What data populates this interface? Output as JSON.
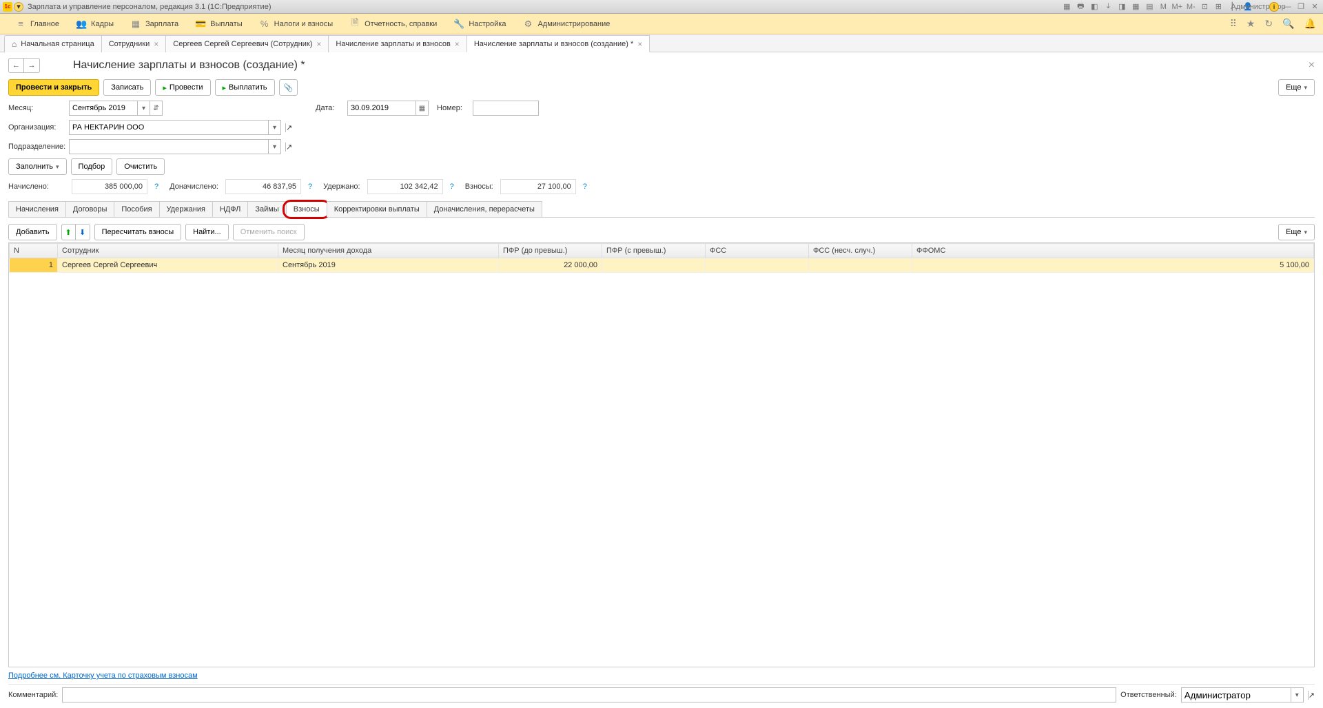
{
  "titlebar": {
    "title": "Зарплата и управление персоналом, редакция 3.1  (1С:Предприятие)",
    "user": "Администратор",
    "m_labels": [
      "M",
      "M+",
      "M-"
    ]
  },
  "mainmenu": {
    "items": [
      {
        "label": "Главное"
      },
      {
        "label": "Кадры"
      },
      {
        "label": "Зарплата"
      },
      {
        "label": "Выплаты"
      },
      {
        "label": "Налоги и взносы"
      },
      {
        "label": "Отчетность, справки"
      },
      {
        "label": "Настройка"
      },
      {
        "label": "Администрирование"
      }
    ]
  },
  "tabs": {
    "home": "Начальная страница",
    "items": [
      {
        "label": "Сотрудники"
      },
      {
        "label": "Сергеев Сергей Сергеевич (Сотрудник)"
      },
      {
        "label": "Начисление зарплаты и взносов"
      },
      {
        "label": "Начисление зарплаты и взносов (создание) *",
        "active": true
      }
    ]
  },
  "page": {
    "title": "Начисление зарплаты и взносов (создание) *"
  },
  "toolbar": {
    "post_close": "Провести и закрыть",
    "save": "Записать",
    "post": "Провести",
    "pay": "Выплатить",
    "more": "Еще"
  },
  "form": {
    "month_label": "Месяц:",
    "month_value": "Сентябрь 2019",
    "date_label": "Дата:",
    "date_value": "30.09.2019",
    "number_label": "Номер:",
    "number_value": "",
    "org_label": "Организация:",
    "org_value": "РА НЕКТАРИН ООО",
    "dept_label": "Подразделение:",
    "dept_value": ""
  },
  "fillrow": {
    "fill": "Заполнить",
    "pick": "Подбор",
    "clear": "Очистить"
  },
  "totals": {
    "accrued_label": "Начислено:",
    "accrued": "385 000,00",
    "extra_label": "Доначислено:",
    "extra": "46 837,95",
    "withheld_label": "Удержано:",
    "withheld": "102 342,42",
    "contrib_label": "Взносы:",
    "contrib": "27 100,00"
  },
  "doctabs": {
    "items": [
      {
        "label": "Начисления"
      },
      {
        "label": "Договоры"
      },
      {
        "label": "Пособия"
      },
      {
        "label": "Удержания"
      },
      {
        "label": "НДФЛ"
      },
      {
        "label": "Займы"
      },
      {
        "label": "Взносы",
        "active": true,
        "highlight": true
      },
      {
        "label": "Корректировки выплаты"
      },
      {
        "label": "Доначисления, перерасчеты"
      }
    ]
  },
  "subtoolbar": {
    "add": "Добавить",
    "recalc": "Пересчитать взносы",
    "find": "Найти...",
    "cancel_find": "Отменить поиск",
    "more": "Еще"
  },
  "table": {
    "headers": {
      "n": "N",
      "employee": "Сотрудник",
      "month": "Месяц получения дохода",
      "pfr_before": "ПФР (до превыш.)",
      "pfr_after": "ПФР (с превыш.)",
      "fss": "ФСС",
      "fss_accident": "ФСС (несч. случ.)",
      "ffoms": "ФФОМС"
    },
    "rows": [
      {
        "n": "1",
        "employee": "Сергеев Сергей Сергеевич",
        "month": "Сентябрь 2019",
        "pfr_before": "22 000,00",
        "pfr_after": "",
        "fss": "",
        "fss_accident": "",
        "ffoms": "5 100,00"
      }
    ]
  },
  "link": "Подробнее см. Карточку учета по страховым взносам",
  "footer": {
    "comment_label": "Комментарий:",
    "comment_value": "",
    "resp_label": "Ответственный:",
    "resp_value": "Администратор"
  }
}
